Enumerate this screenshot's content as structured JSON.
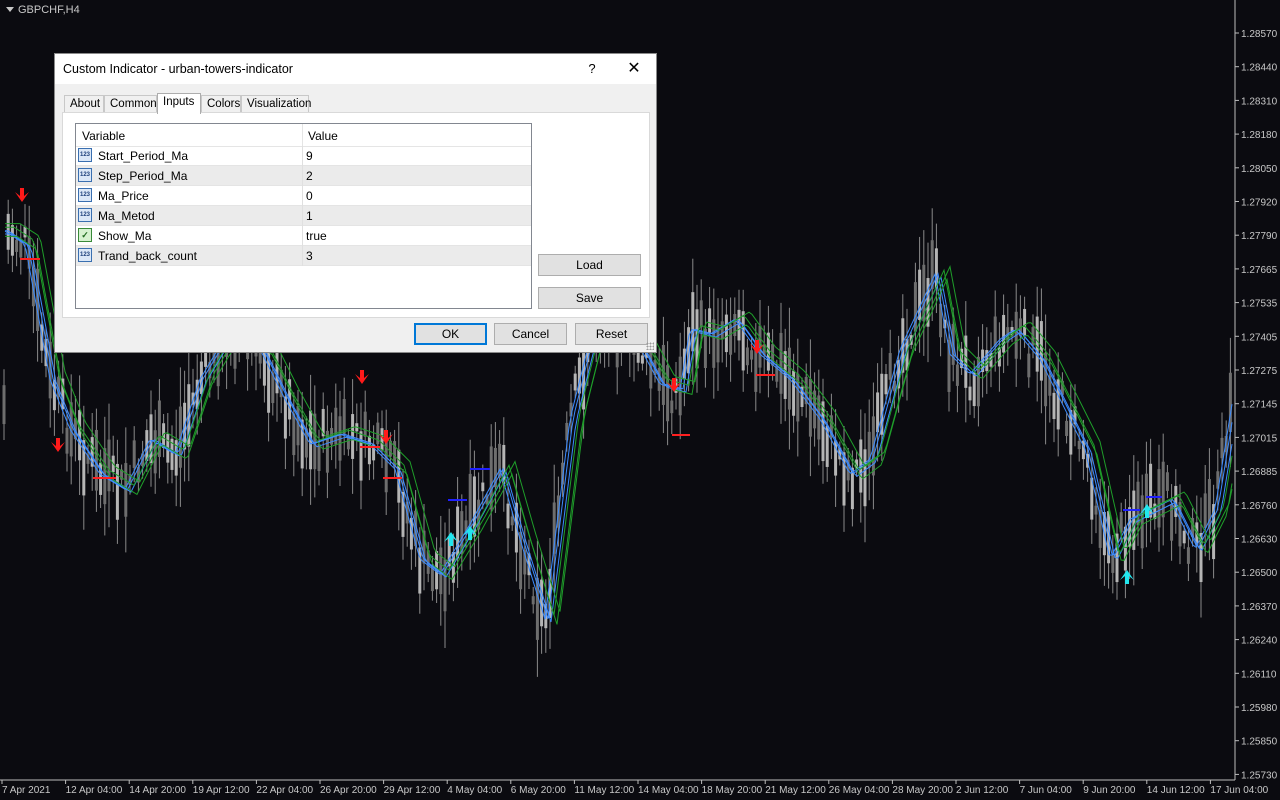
{
  "chart": {
    "symbol": "GBPCHF,H4",
    "y_ticks": [
      "1.28570",
      "1.28440",
      "1.28310",
      "1.28180",
      "1.28050",
      "1.27920",
      "1.27790",
      "1.27665",
      "1.27535",
      "1.27405",
      "1.27275",
      "1.27145",
      "1.27015",
      "1.26885",
      "1.26760",
      "1.26630",
      "1.26500",
      "1.26370",
      "1.26240",
      "1.26110",
      "1.25980",
      "1.25850",
      "1.25730"
    ],
    "x_ticks": [
      "7 Apr 2021",
      "12 Apr 04:00",
      "14 Apr 20:00",
      "19 Apr 12:00",
      "22 Apr 04:00",
      "26 Apr 20:00",
      "29 Apr 12:00",
      "4 May 04:00",
      "6 May 20:00",
      "11 May 12:00",
      "14 May 04:00",
      "18 May 20:00",
      "21 May 12:00",
      "26 May 04:00",
      "28 May 20:00",
      "2 Jun 12:00",
      "7 Jun 04:00",
      "9 Jun 20:00",
      "14 Jun 12:00",
      "17 Jun 04:00"
    ],
    "colors": {
      "background": "#0b0b10",
      "candle": "#9a9a9a",
      "ma_blue": "#3c8cff",
      "ma_green": "#1f9e2a",
      "sell_arrow": "#ff1a1a",
      "buy_arrow": "#22e6ee",
      "sell_level": "#ff2020",
      "buy_level": "#2020ff"
    }
  },
  "dialog": {
    "title": "Custom Indicator - urban-towers-indicator",
    "help": "?",
    "close": "✕",
    "tabs": [
      {
        "label": "About"
      },
      {
        "label": "Common"
      },
      {
        "label": "Inputs"
      },
      {
        "label": "Colors"
      },
      {
        "label": "Visualization"
      }
    ],
    "active_tab": "Inputs",
    "table": {
      "col_variable": "Variable",
      "col_value": "Value",
      "rows": [
        {
          "icon": "123",
          "name": "Start_Period_Ma",
          "value": "9"
        },
        {
          "icon": "123",
          "name": "Step_Period_Ma",
          "value": "2"
        },
        {
          "icon": "123",
          "name": "Ma_Price",
          "value": "0"
        },
        {
          "icon": "123",
          "name": "Ma_Metod",
          "value": "1"
        },
        {
          "icon": "bool",
          "name": "Show_Ma",
          "value": "true"
        },
        {
          "icon": "123",
          "name": "Trand_back_count",
          "value": "3"
        }
      ]
    },
    "buttons": {
      "load": "Load",
      "save": "Save",
      "ok": "OK",
      "cancel": "Cancel",
      "reset": "Reset"
    }
  }
}
